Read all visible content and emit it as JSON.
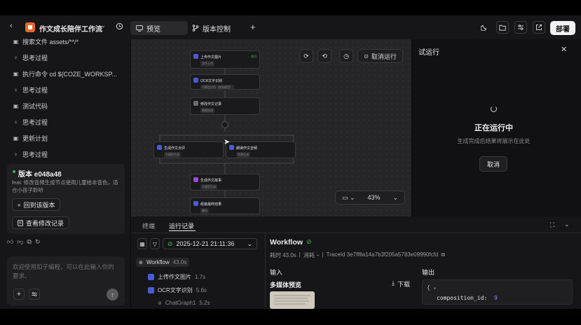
{
  "header": {
    "app_title": "作文成长陪伴工作流",
    "tabs": [
      {
        "label": "预览"
      },
      {
        "label": "版本控制"
      }
    ],
    "deploy_label": "部署"
  },
  "history": {
    "items": [
      {
        "icon": "doc-icon",
        "label": "搜索文件 assets/**/*"
      },
      {
        "icon": "bulb-icon",
        "label": "思考过程"
      },
      {
        "icon": "terminal-icon",
        "label": "执行命令 cd ${COZE_WORKSP..."
      },
      {
        "icon": "bulb-icon",
        "label": "思考过程"
      },
      {
        "icon": "terminal-icon",
        "label": "测试代码"
      },
      {
        "icon": "bulb-icon",
        "label": "思考过程"
      },
      {
        "icon": "doc-icon",
        "label": "更新计划"
      },
      {
        "icon": "bulb-icon",
        "label": "思考过程"
      }
    ]
  },
  "version_card": {
    "title": "版本 e048a48",
    "description": "feat: 修改音频生成节点使用儿童绘本音色，适合小孩子聆听",
    "revert_label": "回到该版本",
    "changes_label": "查看修改记录"
  },
  "chat": {
    "placeholder": "欢迎使用扣子编程，可以在此输入你的要求。"
  },
  "canvas": {
    "nodes": [
      {
        "title": "上传作文图片",
        "sub": "文件上传",
        "badge": "成功",
        "color": "#4a5bd6"
      },
      {
        "title": "OCR文字识别",
        "sub": "大模型识别（视觉模型）",
        "color": "#4a5bd6"
      },
      {
        "title": "修改作文记录",
        "sub": "数据处理",
        "color": "#6b6b70"
      },
      {
        "title": "生成作文点评",
        "sub": "大模型生成",
        "color": "#4a5bd6"
      },
      {
        "title": "朗读作文音频",
        "sub": "音频生成",
        "color": "#4a5bd6"
      },
      {
        "title": "生成作文故事",
        "sub": "大模型生成",
        "color": "#9b4ad6"
      },
      {
        "title": "组装最终结果",
        "sub": "输出",
        "color": "#4a5bd6"
      }
    ],
    "stop_label": "取消运行",
    "zoom": "43%"
  },
  "trial_run": {
    "title": "试运行",
    "status_title": "正在运行中",
    "status_sub": "生成完成后结果将展示在此处",
    "cancel_label": "取消"
  },
  "logs": {
    "tabs": [
      {
        "label": "终端"
      },
      {
        "label": "运行记录"
      }
    ],
    "run_time": "2025-12-21 21:11:36",
    "tree": [
      {
        "label": "Workflow",
        "duration": "43.0s"
      },
      {
        "label": "上传作文图片",
        "duration": "1.7s"
      },
      {
        "label": "OCR文字识别",
        "duration": "5.6s"
      },
      {
        "label": "ChatGraph1",
        "duration": "5.2s"
      }
    ],
    "detail": {
      "title": "Workflow",
      "elapsed": "耗时 43.0s",
      "tokens": "消耗 –",
      "trace": "TraceId 3e7ff8a14a7b3f205a5783e09990fcfd",
      "input_label": "输入",
      "output_label": "输出",
      "media_preview": "多媒体预览",
      "download_label": "下载",
      "json_brace": "{",
      "json_key": "composition_id:",
      "json_value": "9"
    }
  },
  "colors": {
    "accent_orange": "#e8662b",
    "node_blue": "#4a5bd6",
    "node_purple": "#9b4ad6",
    "success_green": "#3fb950"
  }
}
